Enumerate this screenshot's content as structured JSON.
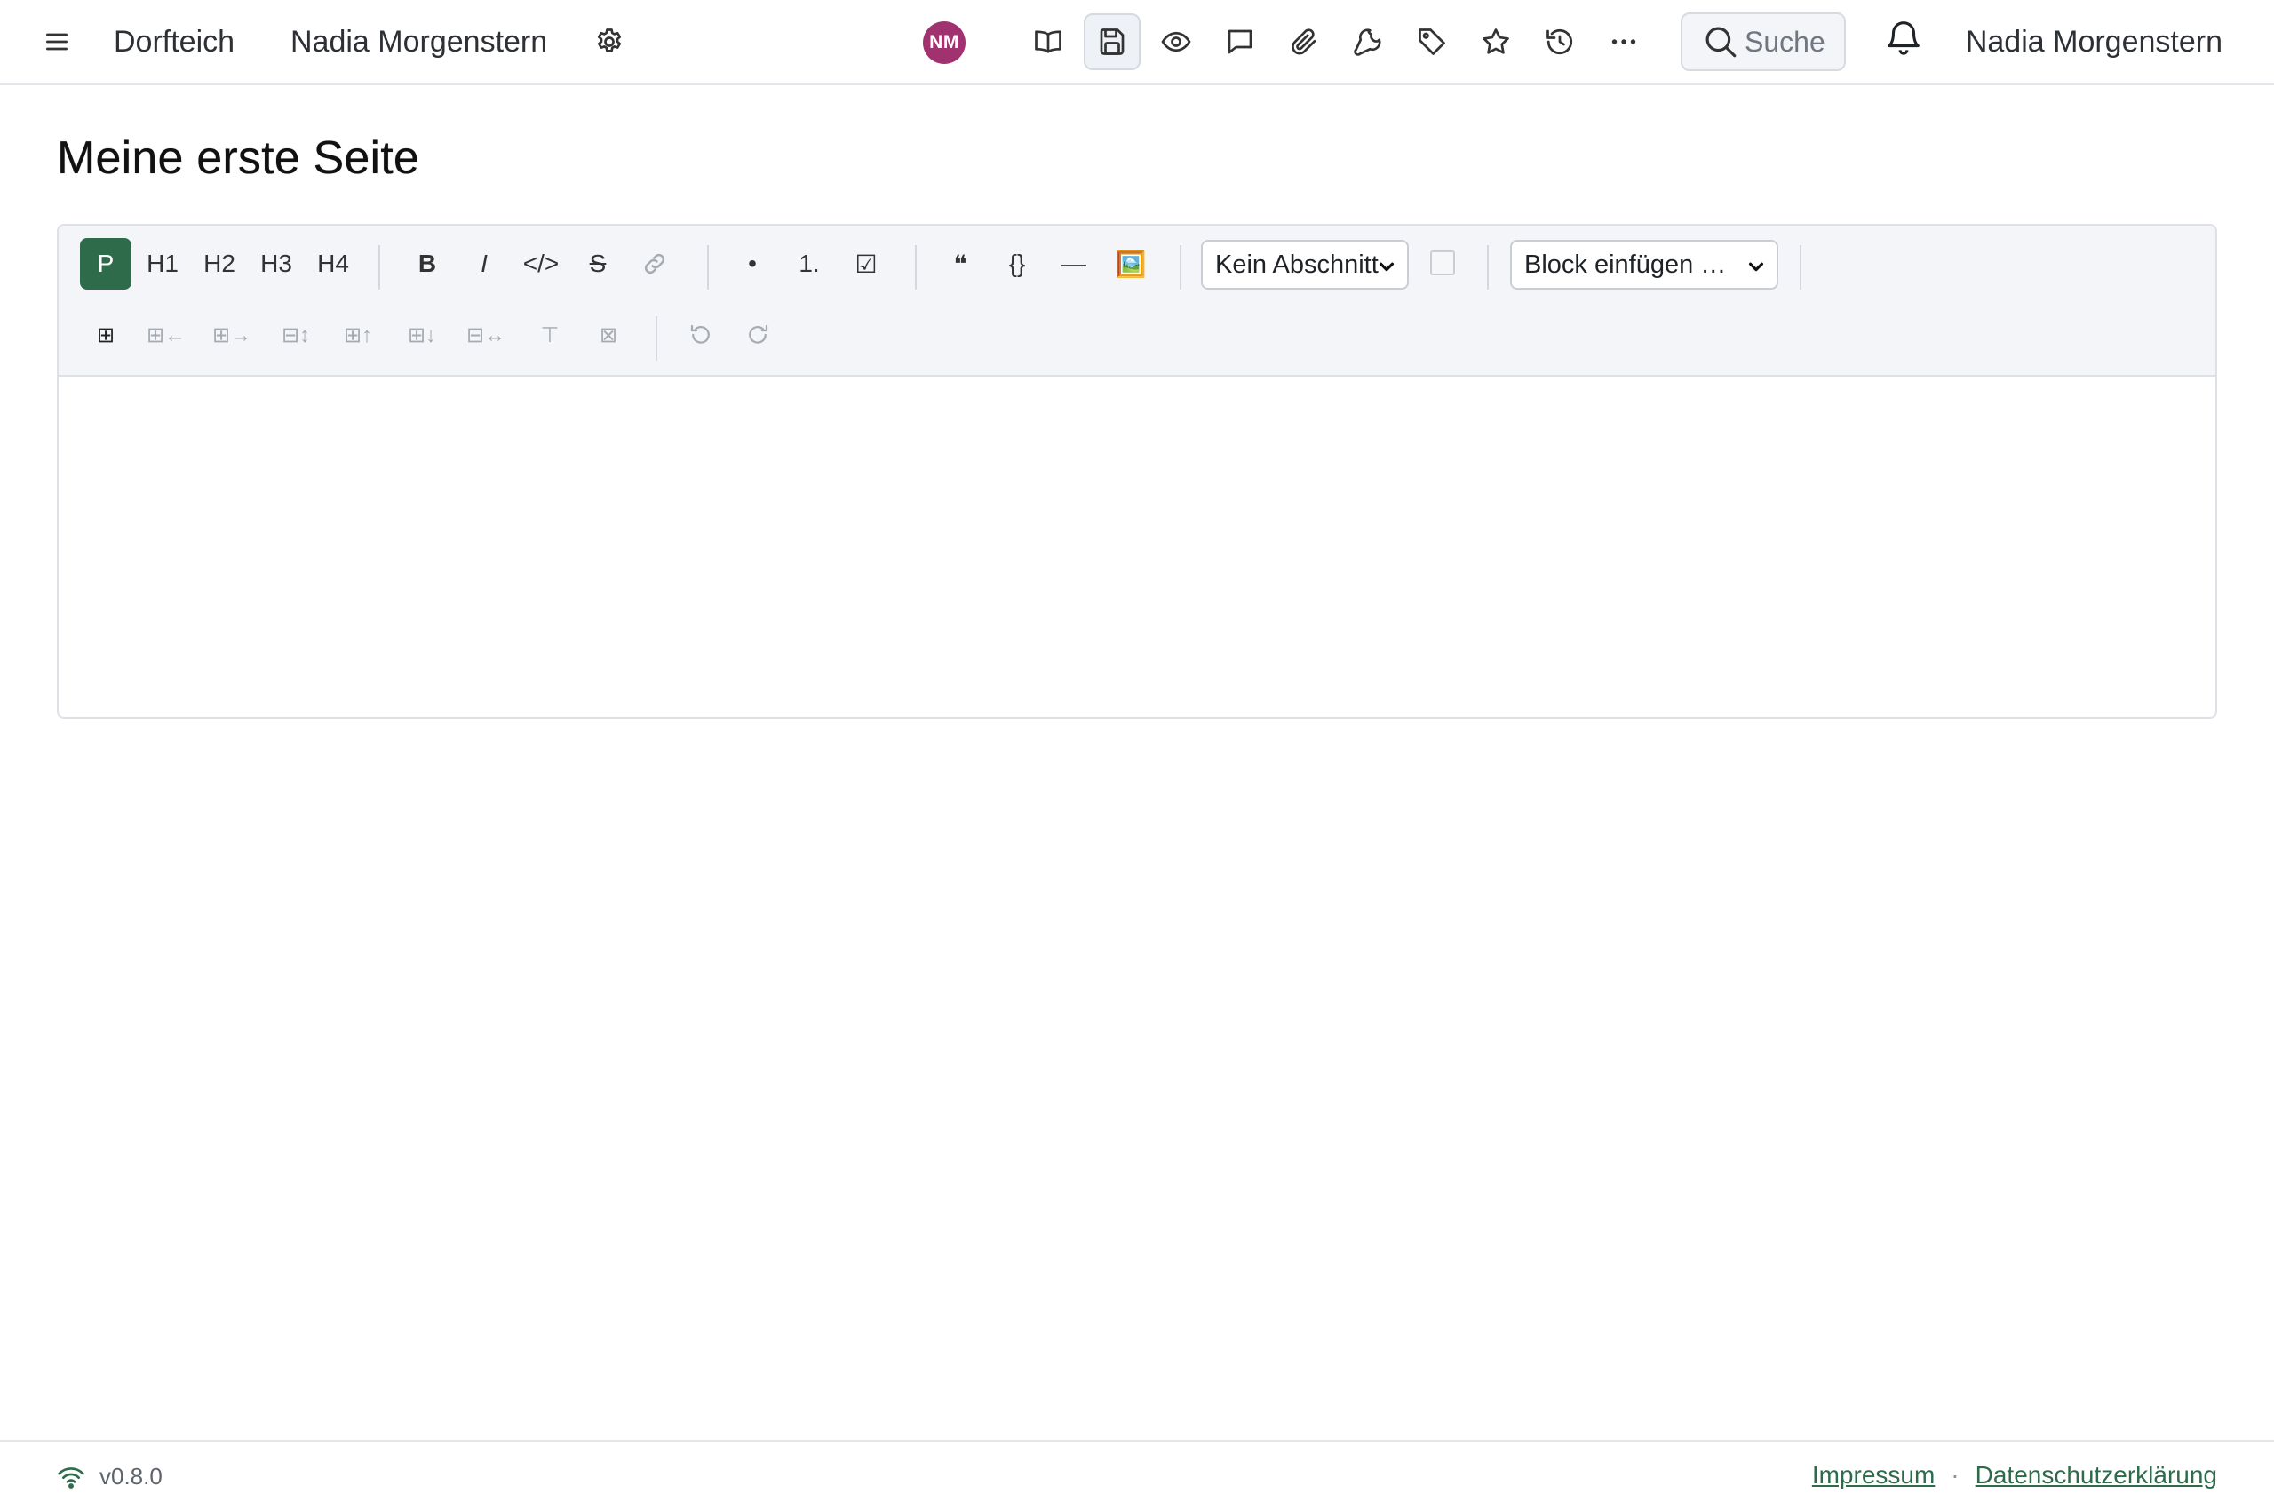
{
  "header": {
    "wiki_name": "Dorfteich",
    "page_owner": "Nadia Morgenstern",
    "avatar_initials": "NM",
    "avatar_color": "#a0336f",
    "search_placeholder": "Suche",
    "user_name": "Nadia Morgenstern",
    "icons": [
      "menu-icon",
      "settings-icon",
      "book-icon",
      "save-icon",
      "eye-icon",
      "comment-icon",
      "paperclip-icon",
      "wrench-icon",
      "tag-icon",
      "star-icon",
      "history-icon",
      "more-icon",
      "search-icon",
      "bell-icon"
    ],
    "active_action": "save"
  },
  "page": {
    "title": "Meine erste Seite"
  },
  "toolbar": {
    "row1": {
      "paragraph": "P",
      "h1": "H1",
      "h2": "H2",
      "h3": "H3",
      "h4": "H4",
      "bold": "B",
      "italic": "I",
      "code": "</>",
      "strike": "S",
      "bullet": "•",
      "ordered": "1.",
      "task": "☑",
      "quote": "❝",
      "codeblock": "{}",
      "hr": "—",
      "image": "🖼️",
      "section_select": "Kein Abschnitt",
      "block_select": "Block einfügen …"
    },
    "row2": {
      "table": "⊞",
      "col_before": "⊞←",
      "col_after": "⊞→",
      "delete_col": "⊟↕",
      "row_before": "⊞↑",
      "row_after": "⊞↓",
      "delete_row": "⊟↔",
      "header_toggle": "⊤",
      "delete_table": "⊠"
    },
    "accent_color": "#2e6b4a"
  },
  "footer": {
    "version": "v0.8.0",
    "impressum": "Impressum",
    "separator": "·",
    "privacy": "Datenschutzerklärung",
    "link_color": "#2e6b4a"
  }
}
